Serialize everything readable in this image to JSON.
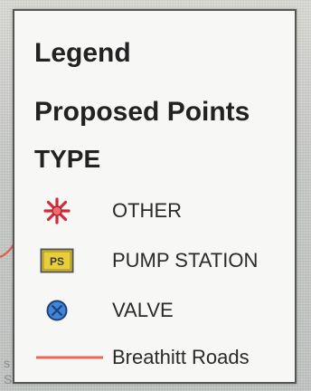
{
  "legend": {
    "title": "Legend",
    "layer_name": "Proposed Points",
    "field_name": "TYPE",
    "items": [
      {
        "label": "OTHER",
        "symbol": "red-asterisk-icon",
        "color": "#e0303a"
      },
      {
        "label": "PUMP STATION",
        "symbol": "pump-station-icon",
        "badge_text": "PS",
        "color": "#e8cf3a"
      },
      {
        "label": "VALVE",
        "symbol": "valve-icon",
        "color": "#2f72c7"
      },
      {
        "label": "Breathitt Roads",
        "symbol": "road-line-icon",
        "color": "#e86b5a"
      }
    ]
  },
  "colors": {
    "panel_background": "#f7f7f6",
    "panel_border": "#555555",
    "text": "#222222",
    "map_background": "#c9cbc8"
  },
  "map_fragment": {
    "chars": [
      "s",
      "S"
    ]
  }
}
